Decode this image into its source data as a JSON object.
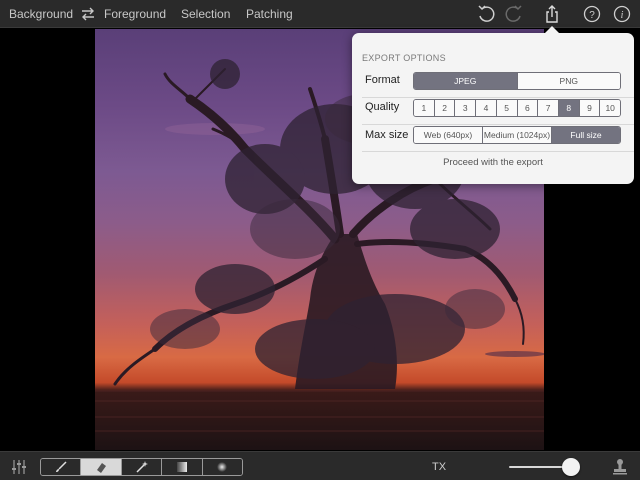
{
  "topbar": {
    "nav": [
      "Background",
      "Foreground",
      "Selection",
      "Patching"
    ],
    "icons": [
      "swap-icon",
      "undo-icon",
      "redo-icon",
      "share-icon",
      "help-icon",
      "info-icon"
    ]
  },
  "export": {
    "title": "EXPORT OPTIONS",
    "format_label": "Format",
    "format_options": [
      "JPEG",
      "PNG"
    ],
    "format_selected": "JPEG",
    "quality_label": "Quality",
    "quality_options": [
      "1",
      "2",
      "3",
      "4",
      "5",
      "6",
      "7",
      "8",
      "9",
      "10"
    ],
    "quality_selected": "8",
    "maxsize_label": "Max size",
    "maxsize_options": [
      "Web (640px)",
      "Medium (1024px)",
      "Full size"
    ],
    "maxsize_selected": "Full size",
    "proceed_label": "Proceed with the export"
  },
  "bottombar": {
    "tools": [
      "brush-icon",
      "eraser-icon",
      "magic-wand-icon",
      "gradient-icon",
      "radial-icon"
    ],
    "selected_tool": "eraser-icon",
    "mode_label": "TX",
    "slider_value": 0.85
  },
  "colors": {
    "bar": "#2a2a2a",
    "segment_selected": "#737380",
    "popover": "#f4f4f4"
  }
}
